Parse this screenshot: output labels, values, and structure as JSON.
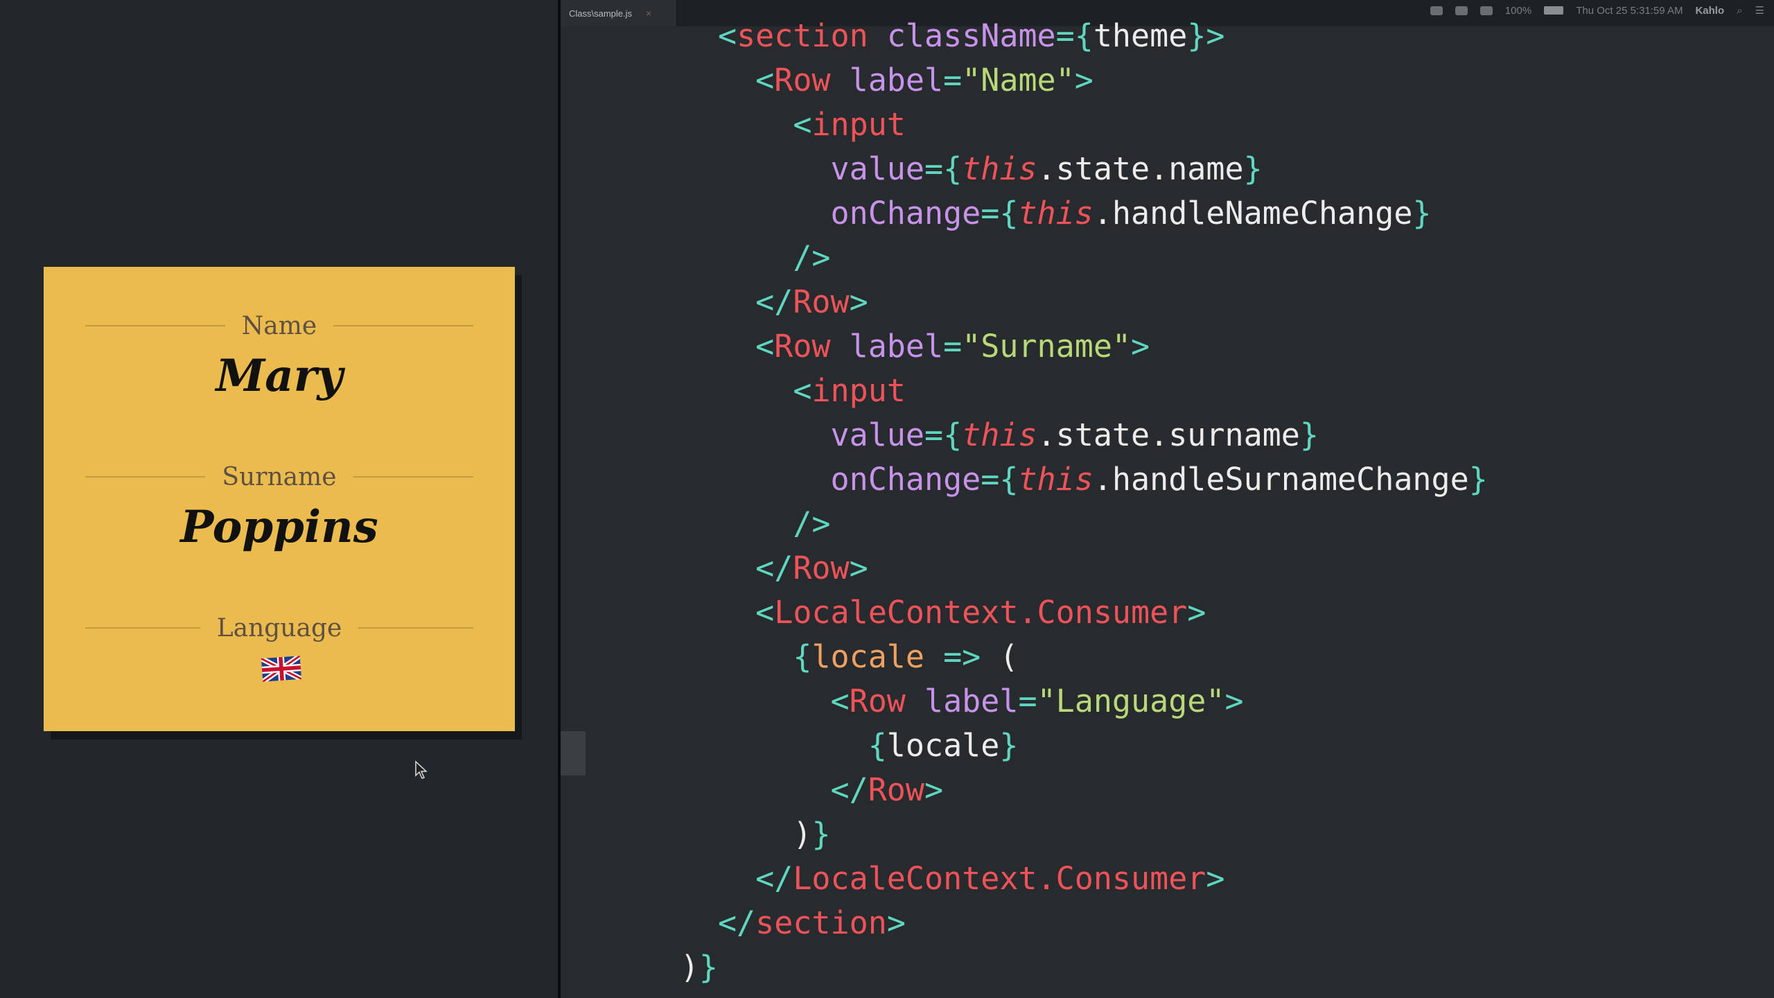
{
  "preview": {
    "card": {
      "name_label": "Name",
      "name_value": "Mary",
      "surname_label": "Surname",
      "surname_value": "Poppins",
      "language_label": "Language",
      "language_icon": "uk-flag-icon"
    }
  },
  "editor": {
    "tab": {
      "title": "Class\\sample.js",
      "close": "×"
    },
    "menubar": {
      "battery": "100%",
      "datetime": "Thu Oct 25  5:31:59 AM",
      "user": "Kahlo"
    },
    "colors": {
      "punct": "#5fd7c0",
      "tag": "#f0525a",
      "attr": "#c792ea",
      "string": "#b8d87a",
      "keyword": "#f0525a",
      "param": "#f0a060"
    },
    "code": [
      {
        "t": [
          [
            "    ",
            "tx"
          ],
          [
            "<",
            "p"
          ],
          [
            "section",
            "tg"
          ],
          [
            " ",
            "tx"
          ],
          [
            "className",
            "at"
          ],
          [
            "={",
            "p"
          ],
          [
            "theme",
            "tx"
          ],
          [
            "}>",
            "p"
          ]
        ]
      },
      {
        "t": [
          [
            "      ",
            "tx"
          ],
          [
            "<",
            "p"
          ],
          [
            "Row",
            "tg"
          ],
          [
            " ",
            "tx"
          ],
          [
            "label",
            "at"
          ],
          [
            "=",
            "p"
          ],
          [
            "\"Name\"",
            "s"
          ],
          [
            ">",
            "p"
          ]
        ]
      },
      {
        "t": [
          [
            "        ",
            "tx"
          ],
          [
            "<",
            "p"
          ],
          [
            "input",
            "tg"
          ]
        ]
      },
      {
        "t": [
          [
            "          ",
            "tx"
          ],
          [
            "value",
            "at"
          ],
          [
            "={",
            "p"
          ],
          [
            "this",
            "kw"
          ],
          [
            ".state.name",
            "tx"
          ],
          [
            "}",
            "p"
          ]
        ]
      },
      {
        "t": [
          [
            "          ",
            "tx"
          ],
          [
            "onChange",
            "at"
          ],
          [
            "={",
            "p"
          ],
          [
            "this",
            "kw"
          ],
          [
            ".handleNameChange",
            "tx"
          ],
          [
            "}",
            "p"
          ]
        ]
      },
      {
        "t": [
          [
            "        ",
            "tx"
          ],
          [
            "/>",
            "p"
          ]
        ]
      },
      {
        "t": [
          [
            "      ",
            "tx"
          ],
          [
            "</",
            "p"
          ],
          [
            "Row",
            "tg"
          ],
          [
            ">",
            "p"
          ]
        ]
      },
      {
        "t": [
          [
            "      ",
            "tx"
          ],
          [
            "<",
            "p"
          ],
          [
            "Row",
            "tg"
          ],
          [
            " ",
            "tx"
          ],
          [
            "label",
            "at"
          ],
          [
            "=",
            "p"
          ],
          [
            "\"Surname\"",
            "s"
          ],
          [
            ">",
            "p"
          ]
        ]
      },
      {
        "t": [
          [
            "        ",
            "tx"
          ],
          [
            "<",
            "p"
          ],
          [
            "input",
            "tg"
          ]
        ]
      },
      {
        "t": [
          [
            "          ",
            "tx"
          ],
          [
            "value",
            "at"
          ],
          [
            "={",
            "p"
          ],
          [
            "this",
            "kw"
          ],
          [
            ".state.surname",
            "tx"
          ],
          [
            "}",
            "p"
          ]
        ]
      },
      {
        "t": [
          [
            "          ",
            "tx"
          ],
          [
            "onChange",
            "at"
          ],
          [
            "={",
            "p"
          ],
          [
            "this",
            "kw"
          ],
          [
            ".handleSurnameChange",
            "tx"
          ],
          [
            "}",
            "p"
          ]
        ]
      },
      {
        "t": [
          [
            "        ",
            "tx"
          ],
          [
            "/>",
            "p"
          ]
        ]
      },
      {
        "t": [
          [
            "      ",
            "tx"
          ],
          [
            "</",
            "p"
          ],
          [
            "Row",
            "tg"
          ],
          [
            ">",
            "p"
          ]
        ]
      },
      {
        "t": [
          [
            "      ",
            "tx"
          ],
          [
            "<",
            "p"
          ],
          [
            "LocaleContext.Consumer",
            "tg"
          ],
          [
            ">",
            "p"
          ]
        ]
      },
      {
        "t": [
          [
            "        ",
            "tx"
          ],
          [
            "{",
            "p"
          ],
          [
            "locale",
            "pm"
          ],
          [
            " => ",
            "p"
          ],
          [
            "(",
            "tx"
          ]
        ]
      },
      {
        "t": [
          [
            "          ",
            "tx"
          ],
          [
            "<",
            "p"
          ],
          [
            "Row",
            "tg"
          ],
          [
            " ",
            "tx"
          ],
          [
            "label",
            "at"
          ],
          [
            "=",
            "p"
          ],
          [
            "\"Language\"",
            "s"
          ],
          [
            ">",
            "p"
          ]
        ]
      },
      {
        "t": [
          [
            "            ",
            "tx"
          ],
          [
            "{",
            "p"
          ],
          [
            "locale",
            "tx"
          ],
          [
            "}",
            "p"
          ]
        ]
      },
      {
        "t": [
          [
            "          ",
            "tx"
          ],
          [
            "</",
            "p"
          ],
          [
            "Row",
            "tg"
          ],
          [
            ">",
            "p"
          ]
        ]
      },
      {
        "t": [
          [
            "        ",
            "tx"
          ],
          [
            ")",
            "tx"
          ],
          [
            "}",
            "p"
          ]
        ]
      },
      {
        "t": [
          [
            "      ",
            "tx"
          ],
          [
            "</",
            "p"
          ],
          [
            "LocaleContext.Consumer",
            "tg"
          ],
          [
            ">",
            "p"
          ]
        ]
      },
      {
        "t": [
          [
            "    ",
            "tx"
          ],
          [
            "</",
            "p"
          ],
          [
            "section",
            "tg"
          ],
          [
            ">",
            "p"
          ]
        ]
      },
      {
        "t": [
          [
            "  ",
            "tx"
          ],
          [
            ")",
            "tx"
          ],
          [
            "}",
            "p"
          ]
        ]
      }
    ]
  }
}
